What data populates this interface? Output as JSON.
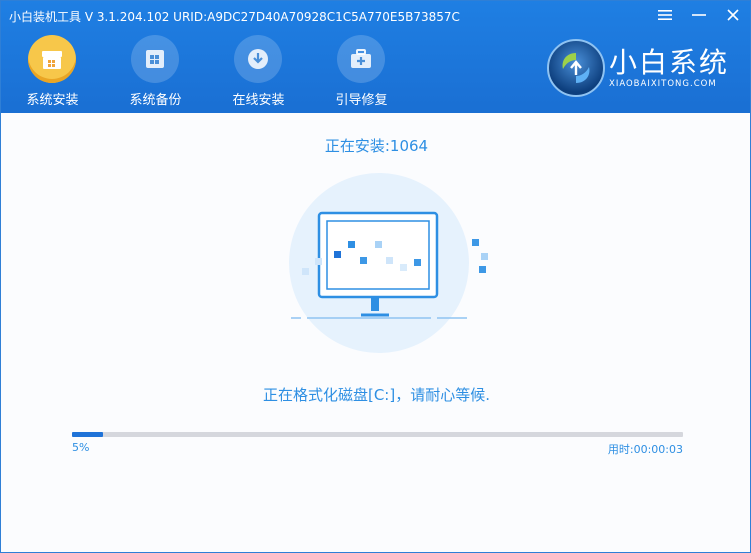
{
  "window": {
    "title": "小白装机工具 V 3.1.204.102 URID:A9DC27D40A70928C1C5A770E5B73857C",
    "menu_icon": "menu-icon",
    "minimize_icon": "minimize-icon",
    "close_icon": "close-icon"
  },
  "nav": {
    "items": [
      {
        "label": "系统安装",
        "icon": "system-install-icon",
        "active": true
      },
      {
        "label": "系统备份",
        "icon": "system-backup-icon",
        "active": false
      },
      {
        "label": "在线安装",
        "icon": "online-install-icon",
        "active": false
      },
      {
        "label": "引导修复",
        "icon": "boot-repair-icon",
        "active": false
      }
    ]
  },
  "brand": {
    "name": "小白系统",
    "subtitle": "XIAOBAIXITONG.COM"
  },
  "main": {
    "installing_label": "正在安装:1064",
    "status_text": "正在格式化磁盘[C:]，请耐心等候.",
    "progress": {
      "percent": 5,
      "percent_label": "5%",
      "elapsed_label": "用时:00:00:03"
    }
  },
  "colors": {
    "header_blue": "#1f7fe3",
    "accent_text": "#2e8fe3",
    "progress_fill": "#1f73d8",
    "active_tab": "#f7c74a"
  }
}
